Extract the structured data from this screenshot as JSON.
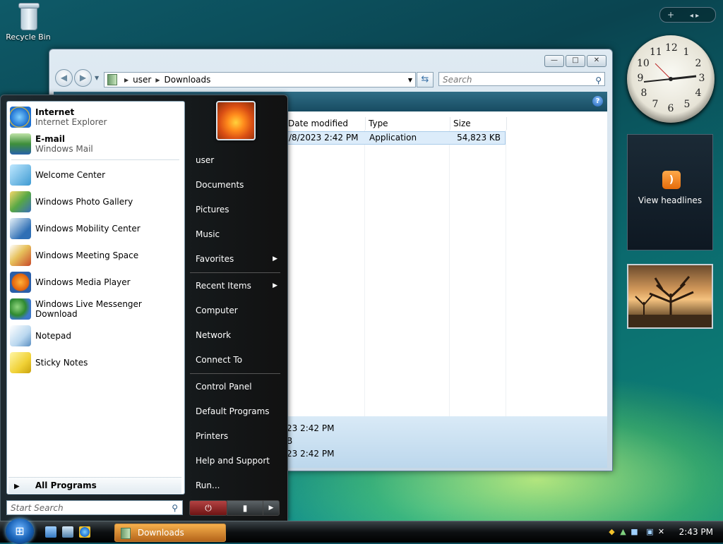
{
  "desktop": {
    "recycle_bin_label": "Recycle Bin"
  },
  "explorer": {
    "address": {
      "segments": [
        "user",
        "Downloads"
      ]
    },
    "search_placeholder": "Search",
    "columns": [
      "Date modified",
      "Type",
      "Size"
    ],
    "file_row": {
      "date": "/8/2023 2:42 PM",
      "type": "Application",
      "size": "54,823 KB"
    },
    "details": [
      "23 2:42 PM",
      "B",
      "23 2:42 PM"
    ],
    "window_buttons": {
      "minimize": "—",
      "maximize": "□",
      "close": "✕"
    }
  },
  "start_menu": {
    "pinned": [
      {
        "title": "Internet",
        "subtitle": "Internet Explorer"
      },
      {
        "title": "E-mail",
        "subtitle": "Windows Mail"
      }
    ],
    "recent": [
      "Welcome Center",
      "Windows Photo Gallery",
      "Windows Mobility Center",
      "Windows Meeting Space",
      "Windows Media Player",
      "Windows Live Messenger Download",
      "Notepad",
      "Sticky Notes"
    ],
    "all_programs": "All Programs",
    "search_placeholder": "Start Search",
    "right_items": {
      "user": "user",
      "documents": "Documents",
      "pictures": "Pictures",
      "music": "Music",
      "favorites": "Favorites",
      "recent_items": "Recent Items",
      "computer": "Computer",
      "network": "Network",
      "connect_to": "Connect To",
      "control_panel": "Control Panel",
      "default_programs": "Default Programs",
      "printers": "Printers",
      "help_support": "Help and Support",
      "run": "Run..."
    }
  },
  "taskbar": {
    "task_label": "Downloads",
    "clock": "2:43 PM"
  },
  "sidebar": {
    "feeds_label": "View headlines",
    "add_button": "+",
    "nav_arrows": "◂ ▸"
  },
  "icons": {
    "start_orb": "windows-logo",
    "search": "magnifier",
    "power": "⏻",
    "lock": "🔒",
    "rss": "rss-feed"
  }
}
